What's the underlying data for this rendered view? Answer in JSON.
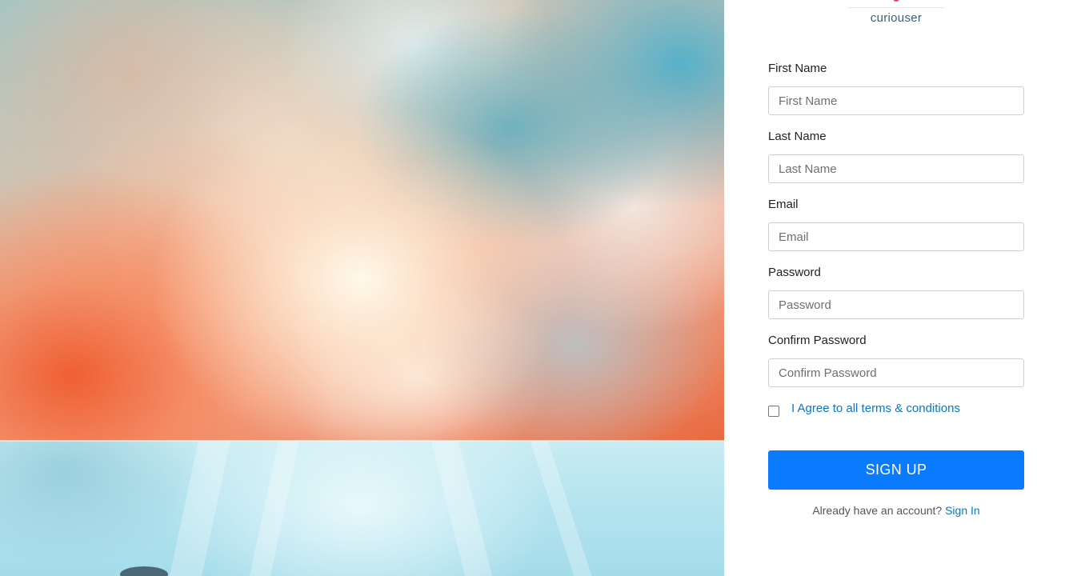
{
  "brand": {
    "logo_text": "curiouser",
    "accent_color": "#e4407a",
    "text_color": "#3b5e7a"
  },
  "hero": {
    "image": "sky-clouds-sunburst-image"
  },
  "form": {
    "fields": [
      {
        "label": "First Name",
        "placeholder": "First Name",
        "value": ""
      },
      {
        "label": "Last Name",
        "placeholder": "Last Name",
        "value": ""
      },
      {
        "label": "Email",
        "placeholder": "Email",
        "value": ""
      },
      {
        "label": "Password",
        "placeholder": "Password",
        "value": ""
      },
      {
        "label": "Confirm Password",
        "placeholder": "Confirm Password",
        "value": ""
      }
    ],
    "terms_label": "I Agree to all terms & conditions",
    "terms_checked": false,
    "submit_label": "SIGN UP",
    "submit_color": "#0a7bff",
    "signin_prompt": "Already have an account?",
    "signin_link": "Sign In",
    "link_color": "#0a78c9"
  }
}
